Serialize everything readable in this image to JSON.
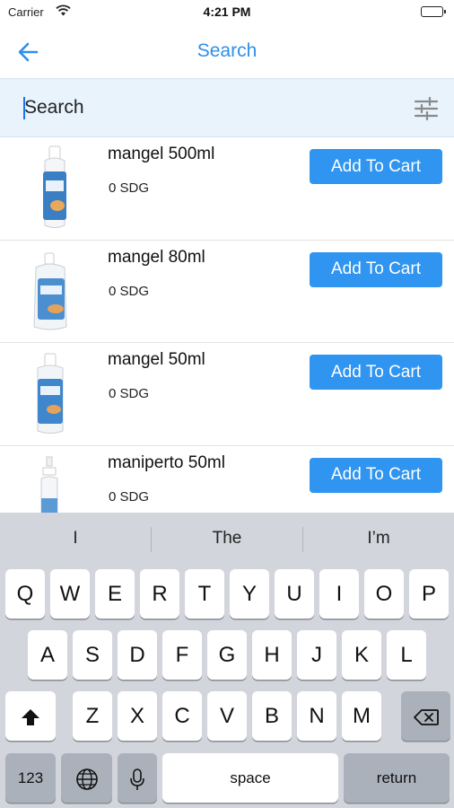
{
  "status_bar": {
    "carrier": "Carrier",
    "time": "4:21 PM"
  },
  "nav": {
    "title": "Search",
    "back_icon": "arrow-left-icon"
  },
  "search": {
    "placeholder": "Search",
    "value": "",
    "filter_icon": "sliders-icon"
  },
  "products": [
    {
      "name": "mangel 500ml",
      "price": "0 SDG",
      "button": "Add To Cart"
    },
    {
      "name": "mangel 80ml",
      "price": "0 SDG",
      "button": "Add To Cart"
    },
    {
      "name": "mangel 50ml",
      "price": "0 SDG",
      "button": "Add To Cart"
    },
    {
      "name": "maniperto 50ml",
      "price": "0 SDG",
      "button": "Add To Cart"
    }
  ],
  "keyboard": {
    "suggestions": [
      "I",
      "The",
      "I’m"
    ],
    "row1": [
      "Q",
      "W",
      "E",
      "R",
      "T",
      "Y",
      "U",
      "I",
      "O",
      "P"
    ],
    "row2": [
      "A",
      "S",
      "D",
      "F",
      "G",
      "H",
      "J",
      "K",
      "L"
    ],
    "row3": [
      "Z",
      "X",
      "C",
      "V",
      "B",
      "N",
      "M"
    ],
    "numbers_label": "123",
    "space_label": "space",
    "return_label": "return"
  },
  "colors": {
    "accent": "#2f8fe8",
    "button": "#2f95f0",
    "search_bg": "#e8f3fc",
    "keyboard_bg": "#d2d5db"
  }
}
